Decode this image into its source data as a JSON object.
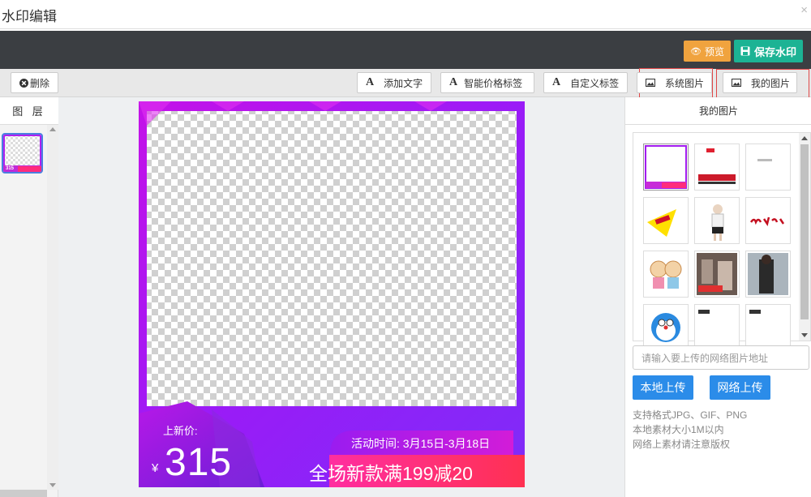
{
  "window": {
    "title": "水印编辑",
    "close": "×"
  },
  "header": {
    "preview_label": "预览",
    "save_label": "保存水印"
  },
  "toolbar": {
    "delete_label": "删除",
    "add_text_label": "添加文字",
    "smart_price_label": "智能价格标签",
    "custom_label": "自定义标签",
    "system_images_label": "系统图片",
    "my_images_label": "我的图片"
  },
  "layers": {
    "title": "图 层"
  },
  "canvas": {
    "price_label": "上新价:",
    "currency": "¥",
    "price": "315",
    "activity_time": "活动时间: 3月15日-3月18日",
    "promo": "全场新款满199减20",
    "thumb_price": "315"
  },
  "right_panel": {
    "title": "我的图片",
    "url_placeholder": "请输入要上传的网络图片地址",
    "local_upload": "本地上传",
    "web_upload": "网络上传",
    "notes": [
      "支持格式JPG、GIF、PNG",
      "本地素材大小1M以内",
      "网络上素材请注意版权"
    ]
  },
  "colors": {
    "accent_purple": "#a11cf5",
    "promo_pink": "#ff2c7d",
    "blue": "#2b8ce9",
    "green": "#1cb394",
    "orange": "#f0a33e"
  }
}
